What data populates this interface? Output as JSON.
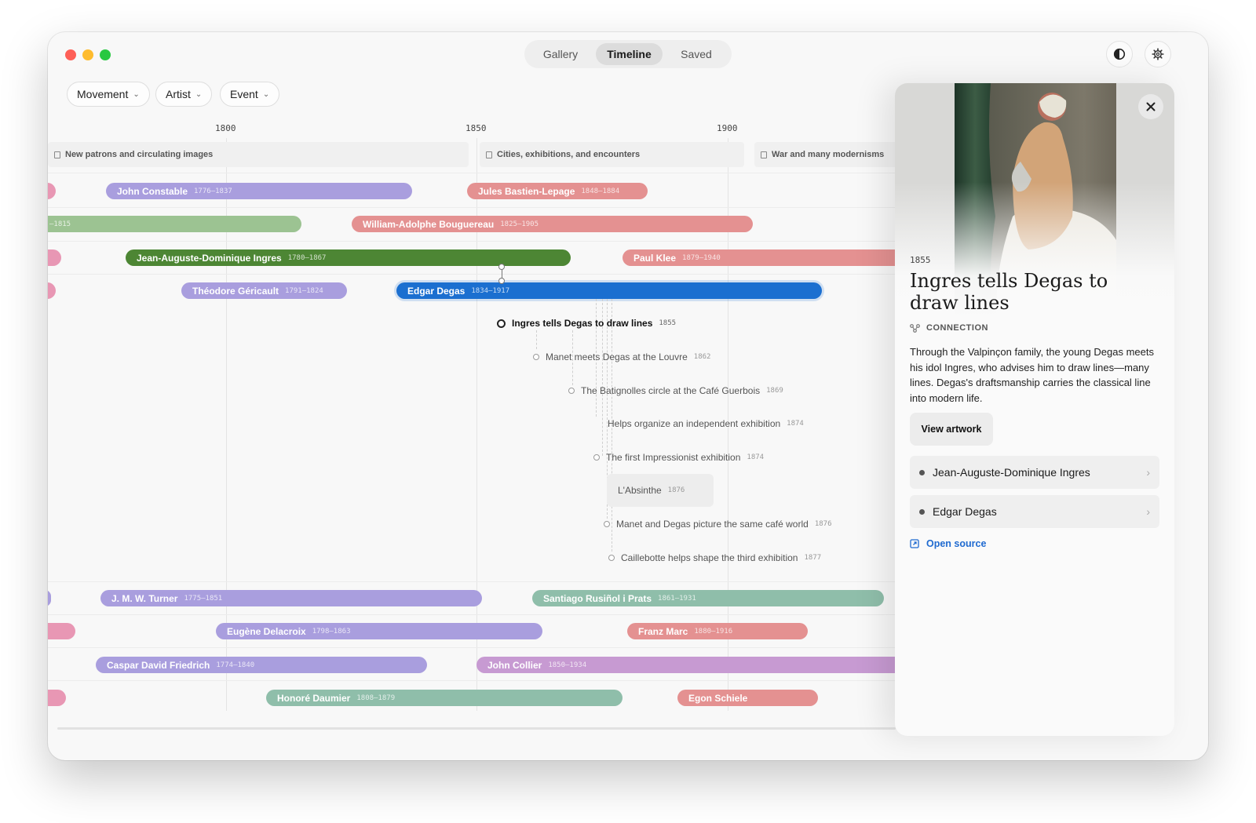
{
  "nav": {
    "tabs": [
      {
        "label": "Gallery"
      },
      {
        "label": "Timeline"
      },
      {
        "label": "Saved"
      }
    ],
    "active": "Timeline"
  },
  "header": {
    "theme_toggle_icon": "contrast-icon",
    "settings_icon": "gear-icon"
  },
  "filters": [
    {
      "label": "Movement"
    },
    {
      "label": "Artist"
    },
    {
      "label": "Event"
    }
  ],
  "timeline": {
    "years": [
      "1800",
      "1850",
      "1900"
    ],
    "eras": [
      {
        "label": "New patrons and circulating images"
      },
      {
        "label": "Cities, exhibitions, and encounters"
      },
      {
        "label": "War and many modernisms"
      }
    ],
    "rows": [
      [
        {
          "name": "John Constable",
          "years": "1776–1837",
          "color": "#a99ede"
        },
        {
          "name": "Jules Bastien-Lepage",
          "years": "1848–1884",
          "color": "#e49191"
        }
      ],
      [
        {
          "name": "",
          "years": "–1815",
          "color": "#9cc392"
        },
        {
          "name": "William-Adolphe Bouguereau",
          "years": "1825–1905",
          "color": "#e49191"
        }
      ],
      [
        {
          "name": "Jean-Auguste-Dominique Ingres",
          "years": "1780–1867",
          "color": "#4d8634"
        },
        {
          "name": "Paul Klee",
          "years": "1879–1940",
          "color": "#e49191"
        }
      ],
      [
        {
          "name": "Théodore Géricault",
          "years": "1791–1824",
          "color": "#a99ede"
        },
        {
          "name": "Edgar Degas",
          "years": "1834–1917",
          "color": "#1b6fd0"
        }
      ],
      [
        {
          "name": "J. M. W. Turner",
          "years": "1775–1851",
          "color": "#a99ede"
        },
        {
          "name": "Santiago Rusiñol i Prats",
          "years": "1861–1931",
          "color": "#8fbeaa"
        }
      ],
      [
        {
          "name": "Eugène Delacroix",
          "years": "1798–1863",
          "color": "#a99ede"
        },
        {
          "name": "Franz Marc",
          "years": "1880–1916",
          "color": "#e49191"
        }
      ],
      [
        {
          "name": "Caspar David Friedrich",
          "years": "1774–1840",
          "color": "#a99ede"
        },
        {
          "name": "John Collier",
          "years": "1850–1934",
          "color": "#c79ad2"
        }
      ],
      [
        {
          "name": "Honoré Daumier",
          "years": "1808–1879",
          "color": "#8fbeaa"
        },
        {
          "name": "Egon Schiele",
          "years": "",
          "color": "#e49191"
        }
      ]
    ],
    "events": [
      {
        "label": "Ingres tells Degas to draw lines",
        "year": "1855",
        "selected": true
      },
      {
        "label": "Manet meets Degas at the Louvre",
        "year": "1862"
      },
      {
        "label": "The Batignolles circle at the Café Guerbois",
        "year": "1869"
      },
      {
        "label": "Helps organize an independent exhibition",
        "year": "1874"
      },
      {
        "label": "The first Impressionist exhibition",
        "year": "1874"
      },
      {
        "label": "L'Absinthe",
        "year": "1876"
      },
      {
        "label": "Manet and Degas picture the same café world",
        "year": "1876"
      },
      {
        "label": "Caillebotte helps shape the third exhibition",
        "year": "1877"
      }
    ]
  },
  "detail": {
    "year": "1855",
    "title": "Ingres tells Degas to draw lines",
    "type": "CONNECTION",
    "description": "Through the Valpinçon family, the young Degas meets his idol Ingres, who advises him to draw lines—many lines. Degas's draftsmanship carries the classical line into modern life.",
    "view_label": "View artwork",
    "related": [
      {
        "label": "Jean-Auguste-Dominique Ingres"
      },
      {
        "label": "Edgar Degas"
      }
    ],
    "source_label": "Open source"
  }
}
